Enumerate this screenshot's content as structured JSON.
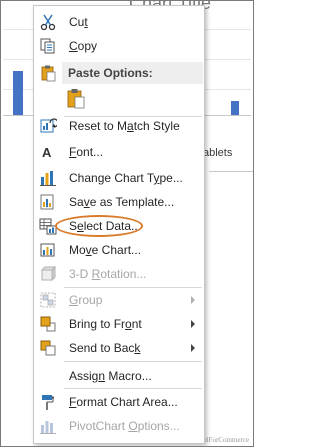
{
  "background": {
    "chart_title_fragment": "Chart Title",
    "axis_label_fragment": "ablets",
    "watermark": "ExcelForCommerce",
    "bar_color": "#4472c4"
  },
  "menu": {
    "cut": {
      "prefix": "Cu",
      "hotkey": "t",
      "suffix": ""
    },
    "copy": {
      "prefix": "",
      "hotkey": "C",
      "suffix": "opy"
    },
    "paste_options_header": "Paste Options:",
    "reset": {
      "prefix": "Reset to M",
      "hotkey": "a",
      "suffix": "tch Style"
    },
    "font": {
      "prefix": "",
      "hotkey": "F",
      "suffix": "ont..."
    },
    "change_chart_type": {
      "prefix": "Change Chart T",
      "hotkey": "y",
      "suffix": "pe..."
    },
    "save_as_template": {
      "prefix": "Sa",
      "hotkey": "v",
      "suffix": "e as Template..."
    },
    "select_data": {
      "prefix": "S",
      "hotkey": "e",
      "suffix": "lect Data..."
    },
    "move_chart": {
      "prefix": "Mo",
      "hotkey": "v",
      "suffix": "e Chart..."
    },
    "rotation_3d": {
      "prefix": "3-D ",
      "hotkey": "R",
      "suffix": "otation..."
    },
    "group": {
      "prefix": "",
      "hotkey": "G",
      "suffix": "roup"
    },
    "bring_to_front": {
      "prefix": "Bring to Fr",
      "hotkey": "o",
      "suffix": "nt"
    },
    "send_to_back": {
      "prefix": "Send to Bac",
      "hotkey": "k",
      "suffix": ""
    },
    "assign_macro": {
      "prefix": "Assig",
      "hotkey": "n",
      "suffix": " Macro..."
    },
    "format_chart_area": {
      "prefix": "",
      "hotkey": "F",
      "suffix": "ormat Chart Area..."
    },
    "pivotchart_options": {
      "prefix": "PivotChart ",
      "hotkey": "O",
      "suffix": "ptions..."
    }
  },
  "colors": {
    "highlight_oval": "#d97a2a",
    "icon_blue": "#2e75b6",
    "icon_orange": "#e3a21a"
  }
}
